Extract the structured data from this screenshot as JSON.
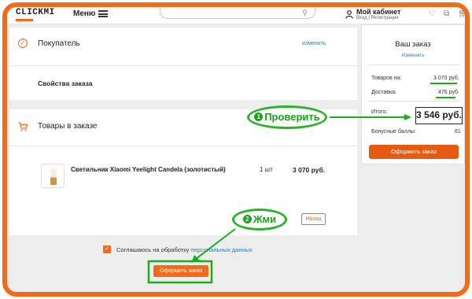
{
  "header": {
    "logo": "CLICKMI",
    "menu_label": "Меню",
    "account_title": "Мой кабинет",
    "account_sub": "Вход | Регистрация"
  },
  "buyer": {
    "title": "Покупатель",
    "edit": "изменить"
  },
  "order_props": {
    "title": "Свойства заказа"
  },
  "goods": {
    "title": "Товары в заказе",
    "item": {
      "name": "Светильник Xiaomi Yeelight Candela (золотистый)",
      "qty": "1 шт",
      "price": "3 070 руб."
    },
    "back": "Назад"
  },
  "agreement": {
    "text": "Соглашаюсь на обработку ",
    "link": "персональных данных"
  },
  "checkout_bottom": "Оформить заказ",
  "summary": {
    "title": "Ваш заказ",
    "edit": "Изменить",
    "goods_label": "Товаров на:",
    "goods_value": "3 070 руб.",
    "delivery_label": "Доставка:",
    "delivery_value": "476 руб.",
    "total_label": "Итого:",
    "total_value": "3 546 руб.",
    "bonus_label": "Бонусные баллы:",
    "bonus_value": "61",
    "checkout": "Оформить заказ"
  },
  "annotations": {
    "check": {
      "number": "1",
      "text": "Проверить"
    },
    "click": {
      "number": "2",
      "text": "Жми"
    }
  },
  "colors": {
    "accent": "#f26a1b",
    "annotation": "#1aae1a",
    "link": "#2a7db8"
  }
}
